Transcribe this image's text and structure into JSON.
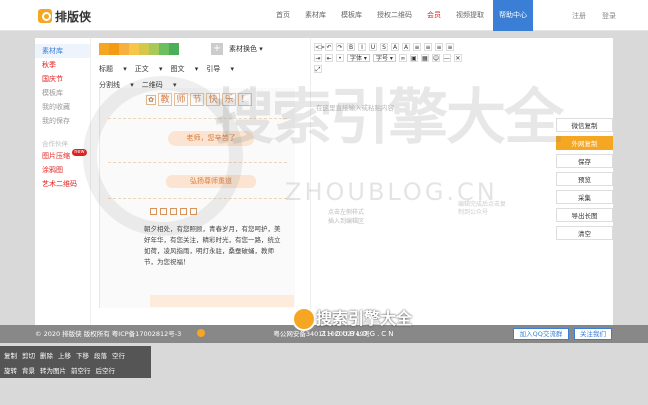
{
  "header": {
    "logo_text": "排版侠",
    "nav": [
      "首页",
      "素材库",
      "模板库",
      "授权二维码",
      "会员",
      "视频提取",
      "帮助中心"
    ],
    "auth": [
      "注册",
      "登录"
    ]
  },
  "sidebar": {
    "items": [
      "素材库",
      "秋季",
      "国庆节",
      "模板库",
      "我的收藏",
      "我的保存"
    ],
    "group_label": "合作伙伴",
    "partners": [
      "图片压缩",
      "涂鸦图",
      "艺术二维码"
    ],
    "new_badge": "new"
  },
  "panel": {
    "color_select": "素材换色",
    "tabs": [
      "标题",
      "正文",
      "图文",
      "引导",
      "分割线",
      "二维码"
    ],
    "preview": {
      "title_chars": [
        "教",
        "师",
        "节",
        "快",
        "乐",
        "！"
      ],
      "pill1": "老师，您辛苦了",
      "pill2": "弘扬尊师重道",
      "body": "朝夕相处，有您照顾，青春岁月，有您呵护，美好年华，有您关注，精彩时光，有您一路，统立如荷，凌风指雨，明灯永驻，桑蚕破蛹，教师节，为您祝福！"
    }
  },
  "editor": {
    "font_select": "字体",
    "size_select": "字号",
    "hint": "在这里直接输入或粘贴内容",
    "hint2": "点击左侧样式\n插入到编辑区",
    "hint3": "编辑完成后点击复制到公众号"
  },
  "actions": [
    "微信复制",
    "外网复制",
    "保存",
    "预览",
    "采集",
    "导出长图",
    "清空"
  ],
  "footer": {
    "copyright": "© 2020 排版侠 版权所有 粤ICP备17002812号-3",
    "police": "粤公网安备34011102002749号",
    "qq_button": "加入QQ交流群",
    "follow_button": "关注我们"
  },
  "context_menu": {
    "row1": [
      "复制",
      "剪切",
      "删除",
      "上移",
      "下移",
      "段落",
      "空行"
    ],
    "row2": [
      "旋转",
      "背景",
      "转为图片",
      "前空行",
      "后空行"
    ]
  },
  "watermark": {
    "cn": "搜索引擎大全",
    "en": "ZHOUBLOG.CN"
  },
  "colors": {
    "accent": "#3a7fd5",
    "orange": "#f5a623",
    "red": "#e02020",
    "swatches": [
      "#f5a623",
      "#f39c12",
      "#f5b041",
      "#f7c548",
      "#d4c84a",
      "#a6c95a",
      "#6cbf5f",
      "#4dae59"
    ]
  }
}
